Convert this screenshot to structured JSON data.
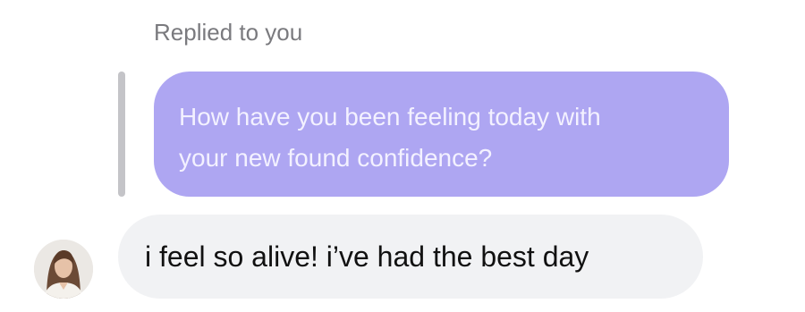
{
  "reply_context": {
    "label": "Replied to you"
  },
  "quoted_message": {
    "line1": "How have you been feeling today with",
    "line2": "your new found confidence?",
    "bubble_color": "#aea6f2"
  },
  "message": {
    "text": "i feel so alive! i’ve had the best day",
    "bubble_color": "#f1f2f4",
    "sender_avatar": "profile-photo"
  }
}
